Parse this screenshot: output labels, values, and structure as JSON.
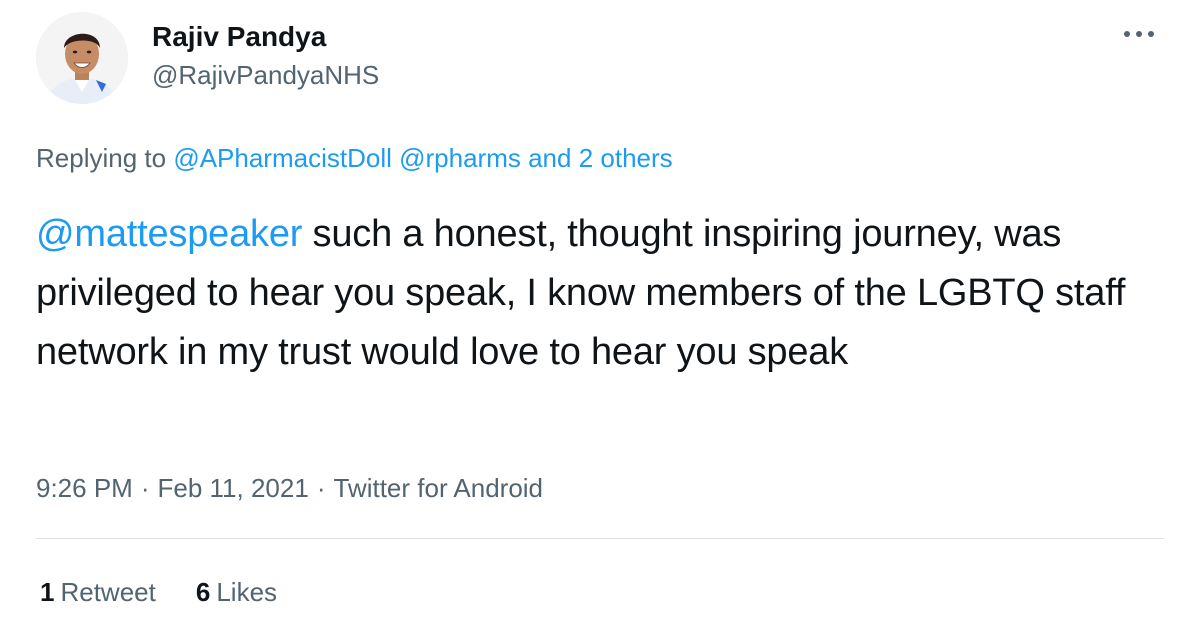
{
  "author": {
    "display_name": "Rajiv Pandya",
    "handle": "@RajivPandyaNHS",
    "avatar_icon": "profile-photo"
  },
  "more_icon": "ellipsis-icon",
  "reply": {
    "prefix": "Replying to ",
    "mention_1": "@APharmacistDoll",
    "mention_2": "@rpharms",
    "suffix": "and 2 others"
  },
  "body": {
    "mention": "@mattespeaker",
    "text": " such a honest, thought inspiring journey, was privileged to hear you speak, I know members of the LGBTQ staff network in my trust would love to hear you speak"
  },
  "meta": {
    "time": "9:26 PM",
    "separator": "·",
    "date": "Feb 11, 2021",
    "source": "Twitter for Android"
  },
  "stats": {
    "retweets_count": "1",
    "retweets_label": "Retweet",
    "likes_count": "6",
    "likes_label": "Likes"
  },
  "colors": {
    "accent": "#1d9bf0",
    "muted": "#536471",
    "text": "#0f1419",
    "divider": "#dfe3e6"
  }
}
